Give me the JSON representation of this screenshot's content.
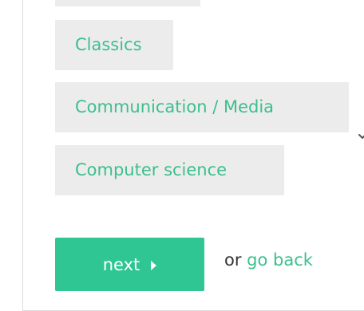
{
  "categories": {
    "items": [
      {
        "label": "Classics"
      },
      {
        "label": "Communication / Media"
      },
      {
        "label": "Computer science"
      }
    ]
  },
  "actions": {
    "next_label": "next",
    "back_prefix": "or",
    "back_link": "go back"
  },
  "colors": {
    "accent": "#2fc693",
    "chip_bg": "#ececec",
    "chip_text": "#3cbf8e"
  }
}
